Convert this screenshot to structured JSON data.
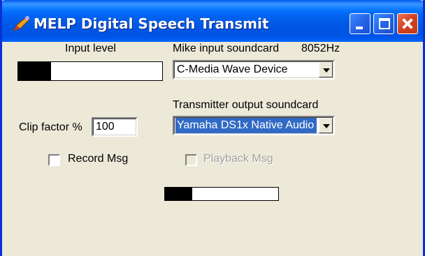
{
  "window": {
    "title": "MELP Digital Speech Transmit",
    "app_icon": "pen-icon",
    "controls": {
      "minimize": "minimize-icon",
      "maximize": "maximize-icon",
      "close": "close-icon"
    }
  },
  "input_level": {
    "label": "Input level",
    "level": 0.23
  },
  "mike_input": {
    "label": "Mike input soundcard",
    "rate": "8052Hz",
    "selected": "C-Media Wave Device"
  },
  "transmitter_output": {
    "label": "Transmitter output soundcard",
    "selected": "Yamaha DS1x Native Audio"
  },
  "clip_factor": {
    "label": "Clip factor %",
    "value": "100"
  },
  "record": {
    "label": "Record Msg",
    "checked": false
  },
  "playback": {
    "label": "Playback Msg",
    "checked": false,
    "enabled": false
  },
  "output_level": {
    "level": 0.24
  },
  "colors": {
    "titlebar": "#0054e3",
    "face": "#ece9d8",
    "selection": "#316ac5",
    "close_button": "#d2401f"
  }
}
